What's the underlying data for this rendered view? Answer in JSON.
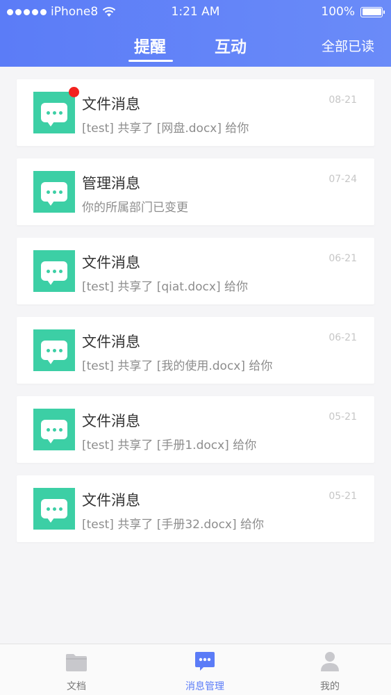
{
  "status_bar": {
    "carrier": "iPhone8",
    "time": "1:21 AM",
    "battery": "100%"
  },
  "header": {
    "tabs": [
      {
        "label": "提醒",
        "active": true
      },
      {
        "label": "互动",
        "active": false
      }
    ],
    "mark_all_read": "全部已读"
  },
  "messages": [
    {
      "title": "文件消息",
      "desc": "[test] 共享了 [网盘.docx] 给你",
      "date": "08-21",
      "unread": true
    },
    {
      "title": "管理消息",
      "desc": "你的所属部门已变更",
      "date": "07-24",
      "unread": false
    },
    {
      "title": "文件消息",
      "desc": "[test] 共享了 [qiat.docx] 给你",
      "date": "06-21",
      "unread": false
    },
    {
      "title": "文件消息",
      "desc": "[test] 共享了 [我的使用.docx] 给你",
      "date": "06-21",
      "unread": false
    },
    {
      "title": "文件消息",
      "desc": "[test] 共享了 [手册1.docx] 给你",
      "date": "05-21",
      "unread": false
    },
    {
      "title": "文件消息",
      "desc": "[test] 共享了 [手册32.docx] 给你",
      "date": "05-21",
      "unread": false
    }
  ],
  "bottom_nav": [
    {
      "label": "文档",
      "icon": "folder-icon",
      "active": false
    },
    {
      "label": "消息管理",
      "icon": "message-icon",
      "active": true
    },
    {
      "label": "我的",
      "icon": "user-icon",
      "active": false
    }
  ],
  "colors": {
    "header": "#5b7cf7",
    "icon_bg": "#3ccfa5",
    "unread": "#f2231f",
    "active_nav": "#5b7cf7"
  }
}
